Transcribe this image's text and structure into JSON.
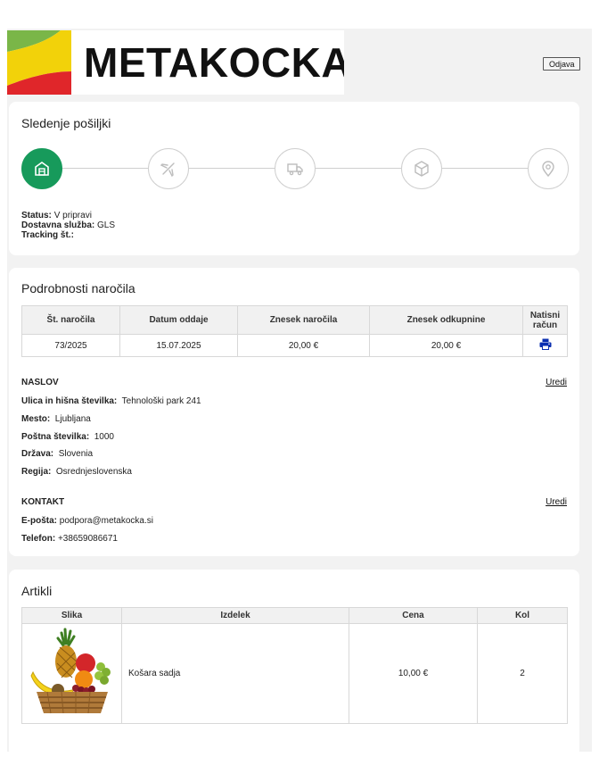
{
  "brand": {
    "name": "METAKOCKA"
  },
  "header": {
    "logout_label": "Odjava"
  },
  "tracking": {
    "title": "Sledenje pošiljki",
    "steps": [
      {
        "icon": "warehouse-icon",
        "active": true
      },
      {
        "icon": "airplane-icon",
        "active": false
      },
      {
        "icon": "delivery-truck-icon",
        "active": false
      },
      {
        "icon": "package-icon",
        "active": false
      },
      {
        "icon": "location-pin-icon",
        "active": false
      }
    ],
    "status_label": "Status:",
    "status_value": "V pripravi",
    "courier_label": "Dostavna služba:",
    "courier_value": "GLS",
    "tracking_label": "Tracking št.:",
    "tracking_value": ""
  },
  "order": {
    "title": "Podrobnosti naročila",
    "columns": [
      "Št. naročila",
      "Datum oddaje",
      "Znesek naročila",
      "Znesek odkupnine",
      "Natisni račun"
    ],
    "row": {
      "number": "73/2025",
      "date": "15.07.2025",
      "amount": "20,00 €",
      "cod_amount": "20,00 €",
      "print_icon": "printer-icon"
    }
  },
  "address": {
    "heading": "NASLOV",
    "edit_label": "Uredi",
    "street_label": "Ulica in hišna številka:",
    "street_value": "Tehnološki park 241",
    "city_label": "Mesto:",
    "city_value": "Ljubljana",
    "postal_label": "Poštna številka:",
    "postal_value": "1000",
    "country_label": "Država:",
    "country_value": "Slovenia",
    "region_label": "Regija:",
    "region_value": "Osrednjeslovenska"
  },
  "contact": {
    "heading": "KONTAKT",
    "edit_label": "Uredi",
    "email_label": "E-pošta:",
    "email_value": "podpora@metakocka.si",
    "phone_label": "Telefon:",
    "phone_value": "+38659086671"
  },
  "items": {
    "title": "Artikli",
    "columns": [
      "Slika",
      "Izdelek",
      "Cena",
      "Kol"
    ],
    "rows": [
      {
        "image": "fruit-basket-image",
        "product": "Košara sadja",
        "price": "10,00 €",
        "quantity": "2"
      }
    ]
  },
  "colors": {
    "accent_green": "#179a5b",
    "print_blue": "#0b2fb0",
    "logo_green": "#7ab648",
    "logo_yellow": "#f2d20a",
    "logo_red": "#e0262a"
  }
}
